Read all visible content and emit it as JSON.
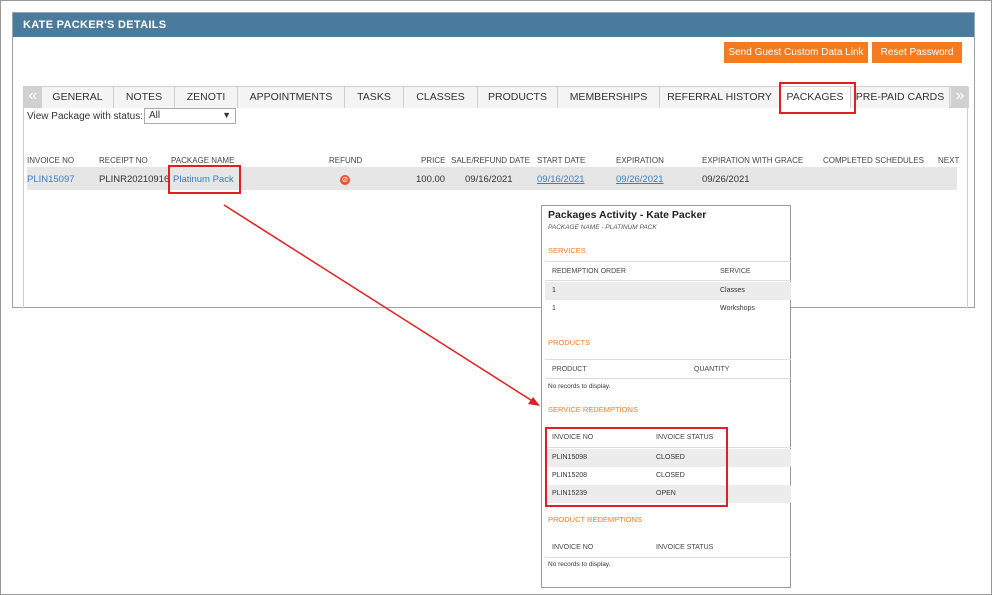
{
  "header": {
    "title": "KATE PACKER'S DETAILS"
  },
  "actions": {
    "send_link": "Send Guest Custom Data Link",
    "reset_password": "Reset Password"
  },
  "tabs": [
    "GENERAL",
    "NOTES",
    "ZENOTI",
    "APPOINTMENTS",
    "TASKS",
    "CLASSES",
    "PRODUCTS",
    "MEMBERSHIPS",
    "REFERRAL HISTORY",
    "PACKAGES",
    "PRE-PAID CARDS"
  ],
  "active_tab": "PACKAGES",
  "filter": {
    "label": "View Package with status:",
    "value": "All"
  },
  "table": {
    "columns": [
      "INVOICE NO",
      "RECEIPT NO",
      "PACKAGE NAME",
      "REFUND",
      "PRICE",
      "SALE/REFUND DATE",
      "START DATE",
      "EXPIRATION",
      "EXPIRATION WITH GRACE",
      "COMPLETED SCHEDULES",
      "NEXT"
    ],
    "row": {
      "invoice": "PLIN15097",
      "receipt": "PLINR20210916",
      "package": "Platinum Pack",
      "price": "100.00",
      "sale_date": "09/16/2021",
      "start_date": "09/16/2021",
      "expiration": "09/26/2021",
      "expiration_grace": "09/26/2021"
    }
  },
  "popup": {
    "title": "Packages Activity - Kate Packer",
    "subtitle": "PACKAGE NAME - PLATINUM PACK",
    "services": {
      "heading": "SERVICES",
      "columns": [
        "REDEMPTION ORDER",
        "SERVICE"
      ],
      "rows": [
        {
          "order": "1",
          "service": "Classes"
        },
        {
          "order": "1",
          "service": "Workshops"
        }
      ]
    },
    "products": {
      "heading": "PRODUCTS",
      "columns": [
        "PRODUCT",
        "QUANTITY"
      ],
      "empty": "No records to display."
    },
    "service_redemptions": {
      "heading": "SERVICE REDEMPTIONS",
      "columns": [
        "INVOICE NO",
        "INVOICE STATUS"
      ],
      "rows": [
        {
          "invoice": "PLIN15098",
          "status": "CLOSED"
        },
        {
          "invoice": "PLIN15208",
          "status": "CLOSED"
        },
        {
          "invoice": "PLIN15239",
          "status": "OPEN"
        }
      ]
    },
    "product_redemptions": {
      "heading": "PRODUCT REDEMPTIONS",
      "columns": [
        "INVOICE NO",
        "INVOICE STATUS"
      ],
      "empty": "No records to display."
    }
  },
  "colors": {
    "header_bg": "#4a7a9c",
    "accent": "#f47b20",
    "link": "#3a7fc1",
    "highlight": "#e02020"
  },
  "icons": {
    "tabs_prev": "double-chevron-left-icon",
    "tabs_next": "double-chevron-right-icon",
    "refund": "no-entry-icon"
  }
}
